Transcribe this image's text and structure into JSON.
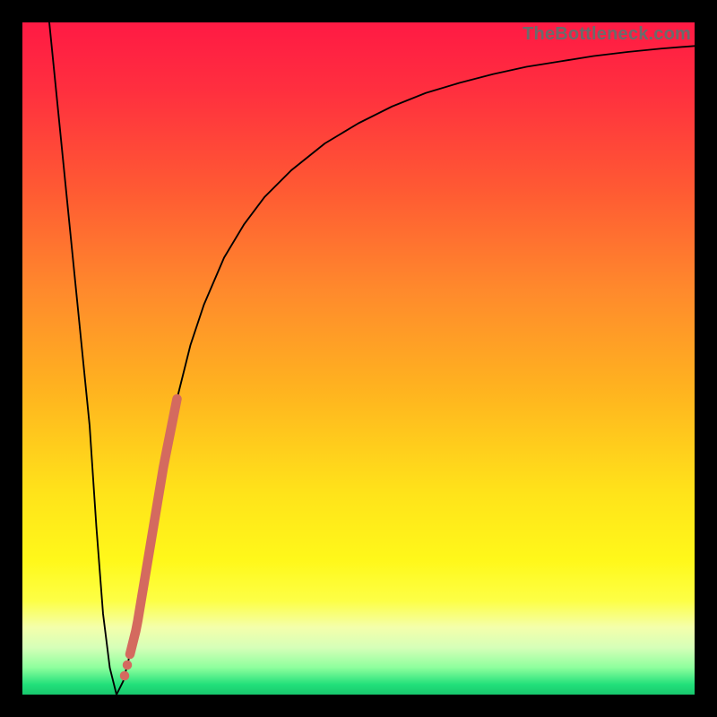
{
  "watermark": "TheBottleneck.com",
  "gradient_stops": [
    {
      "offset": 0.0,
      "color": "#ff1a44"
    },
    {
      "offset": 0.1,
      "color": "#ff2f3f"
    },
    {
      "offset": 0.25,
      "color": "#ff5a33"
    },
    {
      "offset": 0.4,
      "color": "#ff8a2c"
    },
    {
      "offset": 0.55,
      "color": "#ffb41f"
    },
    {
      "offset": 0.7,
      "color": "#ffe31a"
    },
    {
      "offset": 0.8,
      "color": "#fff81a"
    },
    {
      "offset": 0.86,
      "color": "#fdff45"
    },
    {
      "offset": 0.9,
      "color": "#f4ffab"
    },
    {
      "offset": 0.93,
      "color": "#d6ffb8"
    },
    {
      "offset": 0.96,
      "color": "#8dff9d"
    },
    {
      "offset": 0.985,
      "color": "#22e07a"
    },
    {
      "offset": 1.0,
      "color": "#18c76d"
    }
  ],
  "chart_data": {
    "type": "line",
    "title": "",
    "xlabel": "",
    "ylabel": "",
    "xlim": [
      0,
      100
    ],
    "ylim": [
      0,
      100
    ],
    "series": [
      {
        "name": "bottleneck-curve",
        "x": [
          4,
          6,
          8,
          10,
          11,
          12,
          13,
          14,
          15,
          17,
          19,
          21,
          23,
          25,
          27,
          30,
          33,
          36,
          40,
          45,
          50,
          55,
          60,
          65,
          70,
          75,
          80,
          85,
          90,
          95,
          100
        ],
        "y": [
          100,
          80,
          60,
          40,
          25,
          12,
          4,
          0,
          2,
          10,
          22,
          34,
          44,
          52,
          58,
          65,
          70,
          74,
          78,
          82,
          85,
          87.5,
          89.5,
          91,
          92.3,
          93.4,
          94.2,
          95,
          95.6,
          96.1,
          96.5
        ]
      }
    ],
    "highlight_segment": {
      "series": "bottleneck-curve",
      "x_from": 16,
      "x_to": 23,
      "color": "#d46a5f",
      "extra_dots_x": [
        15.2,
        15.6
      ]
    },
    "legend": false,
    "grid": false
  }
}
